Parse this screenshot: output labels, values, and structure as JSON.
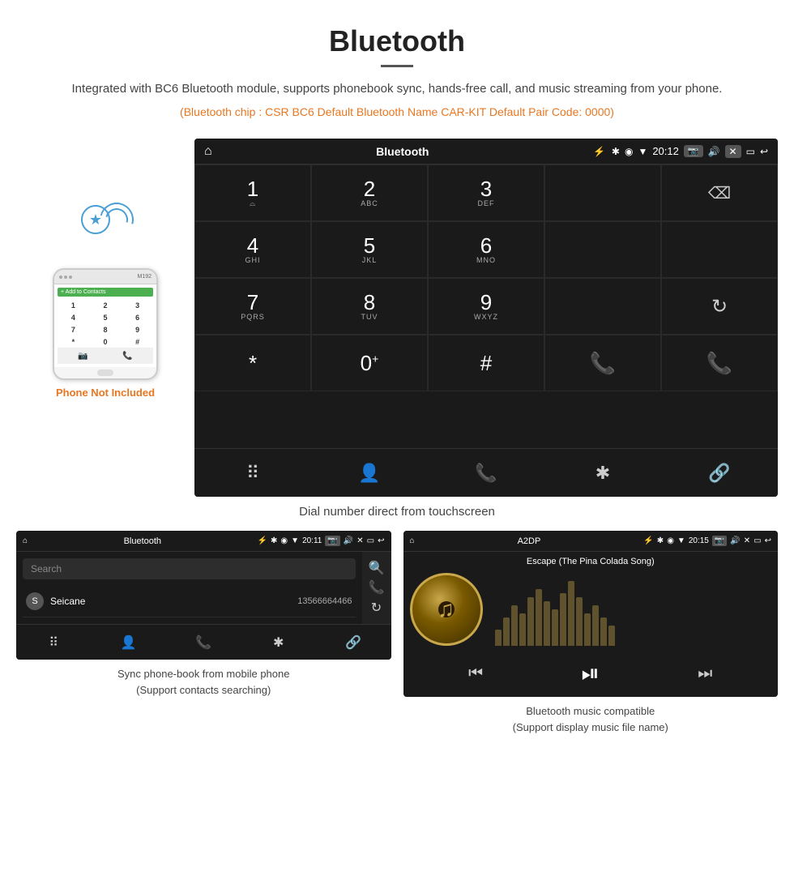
{
  "header": {
    "title": "Bluetooth",
    "description": "Integrated with BC6 Bluetooth module, supports phonebook sync, hands-free call, and music streaming from your phone.",
    "specs": "(Bluetooth chip : CSR BC6    Default Bluetooth Name CAR-KIT    Default Pair Code: 0000)"
  },
  "phone_not_included": "Phone Not Included",
  "car_screen": {
    "status_bar": {
      "home_icon": "⌂",
      "title": "Bluetooth",
      "usb_icon": "⚡",
      "bt_icon": "✱",
      "location_icon": "◉",
      "signal_icon": "▼",
      "time": "20:12",
      "camera_icon": "📷",
      "volume_icon": "🔊",
      "close_icon": "✕",
      "window_icon": "▭",
      "back_icon": "↩"
    },
    "dialpad": [
      {
        "row": 1,
        "keys": [
          {
            "num": "1",
            "letters": "⌓"
          },
          {
            "num": "2",
            "letters": "ABC"
          },
          {
            "num": "3",
            "letters": "DEF"
          },
          {
            "num": "",
            "letters": "",
            "type": "empty"
          },
          {
            "num": "",
            "letters": "",
            "type": "backspace"
          }
        ]
      },
      {
        "row": 2,
        "keys": [
          {
            "num": "4",
            "letters": "GHI"
          },
          {
            "num": "5",
            "letters": "JKL"
          },
          {
            "num": "6",
            "letters": "MNO"
          },
          {
            "num": "",
            "letters": "",
            "type": "empty"
          },
          {
            "num": "",
            "letters": "",
            "type": "empty"
          }
        ]
      },
      {
        "row": 3,
        "keys": [
          {
            "num": "7",
            "letters": "PQRS"
          },
          {
            "num": "8",
            "letters": "TUV"
          },
          {
            "num": "9",
            "letters": "WXYZ"
          },
          {
            "num": "",
            "letters": "",
            "type": "empty"
          },
          {
            "num": "",
            "letters": "",
            "type": "refresh"
          }
        ]
      },
      {
        "row": 4,
        "keys": [
          {
            "num": "*",
            "letters": ""
          },
          {
            "num": "0",
            "letters": "+",
            "type": "zero"
          },
          {
            "num": "#",
            "letters": ""
          },
          {
            "num": "",
            "letters": "",
            "type": "call_green"
          },
          {
            "num": "",
            "letters": "",
            "type": "call_red"
          }
        ]
      }
    ],
    "bottom_nav": [
      {
        "icon": "⠿",
        "type": "dialpad"
      },
      {
        "icon": "👤",
        "type": "contacts"
      },
      {
        "icon": "📞",
        "type": "recents"
      },
      {
        "icon": "✱",
        "type": "bluetooth"
      },
      {
        "icon": "🔗",
        "type": "link"
      }
    ]
  },
  "caption_main": "Dial number direct from touchscreen",
  "phonebook_screen": {
    "status": {
      "home": "⌂",
      "title": "Bluetooth",
      "usb": "⚡",
      "bt": "✱",
      "loc": "◉",
      "sig": "▼",
      "time": "20:11",
      "cam": "📷",
      "vol": "🔊",
      "x": "✕",
      "win": "▭",
      "back": "↩"
    },
    "search_placeholder": "Search",
    "contacts": [
      {
        "initial": "S",
        "name": "Seicane",
        "number": "13566664466"
      }
    ],
    "side_icons": [
      "🔍",
      "📞",
      "↻"
    ],
    "bottom_nav": [
      {
        "icon": "⠿",
        "type": "dialpad"
      },
      {
        "icon": "👤",
        "type": "contacts",
        "active": true
      },
      {
        "icon": "📞",
        "type": "recents"
      },
      {
        "icon": "✱",
        "type": "bluetooth"
      },
      {
        "icon": "🔗",
        "type": "link"
      }
    ]
  },
  "music_screen": {
    "status": {
      "home": "⌂",
      "title": "A2DP",
      "usb": "⚡",
      "bt": "✱",
      "loc": "◉",
      "sig": "▼",
      "time": "20:15",
      "cam": "📷",
      "vol": "🔊",
      "x": "✕",
      "win": "▭",
      "back": "↩"
    },
    "song_title": "Escape (The Pina Colada Song)",
    "controls": {
      "prev": "⏮",
      "play_pause": "⏯",
      "next": "⏭"
    },
    "viz_heights": [
      20,
      35,
      50,
      40,
      60,
      70,
      55,
      45,
      65,
      80,
      60,
      40,
      50,
      35,
      25
    ]
  },
  "captions": {
    "phonebook": "Sync phone-book from mobile phone\n(Support contacts searching)",
    "music": "Bluetooth music compatible\n(Support display music file name)"
  }
}
